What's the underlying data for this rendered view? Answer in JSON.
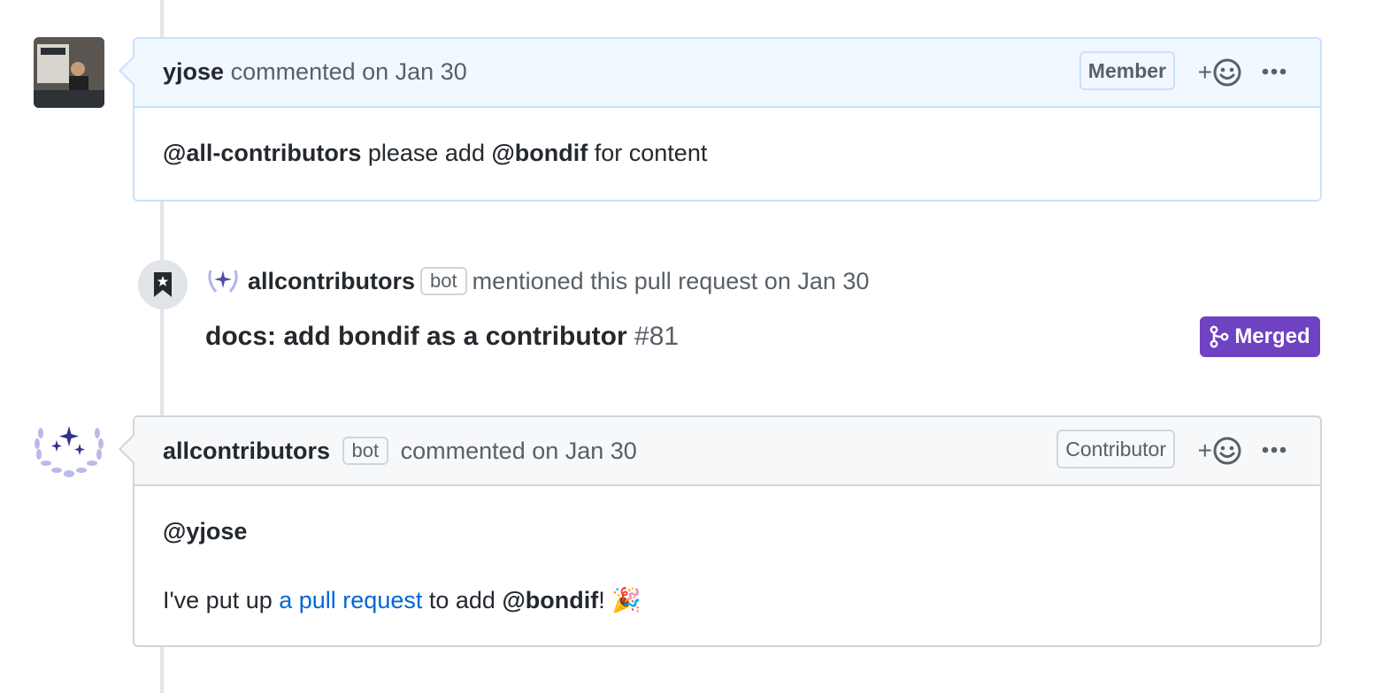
{
  "comments": [
    {
      "author": "yjose",
      "action": "commented on Jan 30",
      "role": "Member",
      "body": {
        "mention_1": "@all-contributors",
        "text_1": " please add ",
        "mention_2": "@bondif",
        "text_2": " for content"
      }
    },
    {
      "author": "allcontributors",
      "bot_label": "bot",
      "action": "commented on Jan 30",
      "role": "Contributor",
      "body": {
        "mention": "@yjose",
        "line_prefix": "I've put up ",
        "link": "a pull request",
        "line_mid": " to add ",
        "mention_2": "@bondif",
        "line_end": "! 🎉"
      }
    }
  ],
  "event": {
    "author": "allcontributors",
    "bot_label": "bot",
    "action": "mentioned this pull request on Jan 30",
    "pr_title": "docs: add bondif as a contributor",
    "pr_number": "#81",
    "status": "Merged"
  },
  "reaction": {
    "plus": "+",
    "icon": "smiley-icon"
  },
  "colors": {
    "merged": "#6f42c1",
    "link": "#0366d6",
    "member_header": "#f1f8ff"
  }
}
